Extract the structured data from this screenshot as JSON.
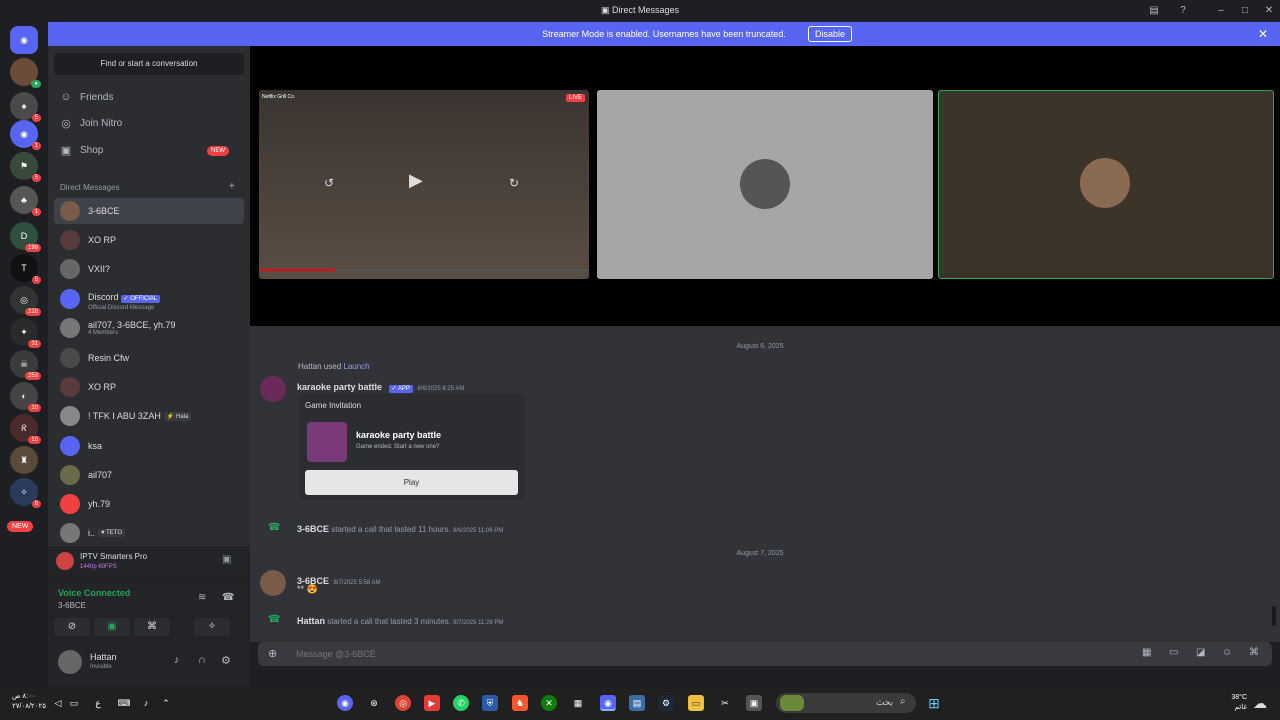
{
  "titlebar": {
    "title": "Direct Messages"
  },
  "banner": {
    "message": "Streamer Mode is enabled. Usernames have been truncated.",
    "disable_label": "Disable"
  },
  "guild_badges": [
    "5",
    "1",
    "5",
    "1",
    "5",
    "199",
    "1",
    "228",
    "31",
    "253",
    "10",
    "16",
    "8"
  ],
  "guild_new": "NEW",
  "sidebar": {
    "find_label": "Find or start a conversation",
    "friends": "Friends",
    "nitro": "Join Nitro",
    "shop": "Shop",
    "shop_badge": "NEW",
    "dm_header": "Direct Messages",
    "dms": [
      {
        "name": "3-6BCE"
      },
      {
        "name": "XO RP"
      },
      {
        "name": "VXII?"
      },
      {
        "name": "Discord",
        "tag": "✓ OFFICIAL",
        "sub": "Official Discord Message"
      },
      {
        "name": "ail707, 3-6BCE, yh.79",
        "sub": "4 Members"
      },
      {
        "name": "Resin Cfw"
      },
      {
        "name": "XO RP"
      },
      {
        "name": "! TFK I ABU 3ZAH",
        "tag": "⚡ Hala"
      },
      {
        "name": "ksa"
      },
      {
        "name": "ail707"
      },
      {
        "name": "yh.79"
      },
      {
        "name": "i..",
        "tag": "♥ TETO"
      }
    ]
  },
  "activity": {
    "app": "IPTV Smarters Pro",
    "quality": "1440p 60FPS"
  },
  "voice": {
    "status": "Voice Connected",
    "channel": "3-6BCE"
  },
  "user": {
    "name": "Hattan",
    "status": "Invisible"
  },
  "stage": {
    "live": "LIVE",
    "video_caption": "Netflix Grill Co."
  },
  "chat": {
    "date1": "August 6, 2025",
    "used_by": "Hattan used",
    "launch": "Launch",
    "app_name": "karaoke party battle",
    "app_tag": "✓ APP",
    "app_time": "8/6/2025 8:25 AM",
    "card_title": "Game Invitation",
    "card_game": "karaoke party battle",
    "card_sub": "Game ended. Start a new one?",
    "play": "Play",
    "call1_who": "3-6BCE",
    "call1_text": "started a call that lasted 11 hours.",
    "call1_time": "8/6/2025 11:06 PM",
    "date2": "August 7, 2025",
    "msg_who": "3-6BCE",
    "msg_time": "8/7/2025 5:58 AM",
    "msg_text": "**",
    "call2_who": "Hattan",
    "call2_text": "started a call that lasted 3 minutes.",
    "call2_time": "8/7/2025 11:28 PM"
  },
  "composer": {
    "placeholder": "Message @3-6BCE"
  },
  "taskbar": {
    "time": "٨:٠٠ ص",
    "date": "٢٧/٠٨/٢٠٢٥",
    "search": "بحث",
    "weather_temp": "38°C",
    "weather_desc": "غائم"
  },
  "colors": {
    "blurple": "#5865f2",
    "green": "#23a55a",
    "red": "#f23f42",
    "bg": "#313338"
  }
}
